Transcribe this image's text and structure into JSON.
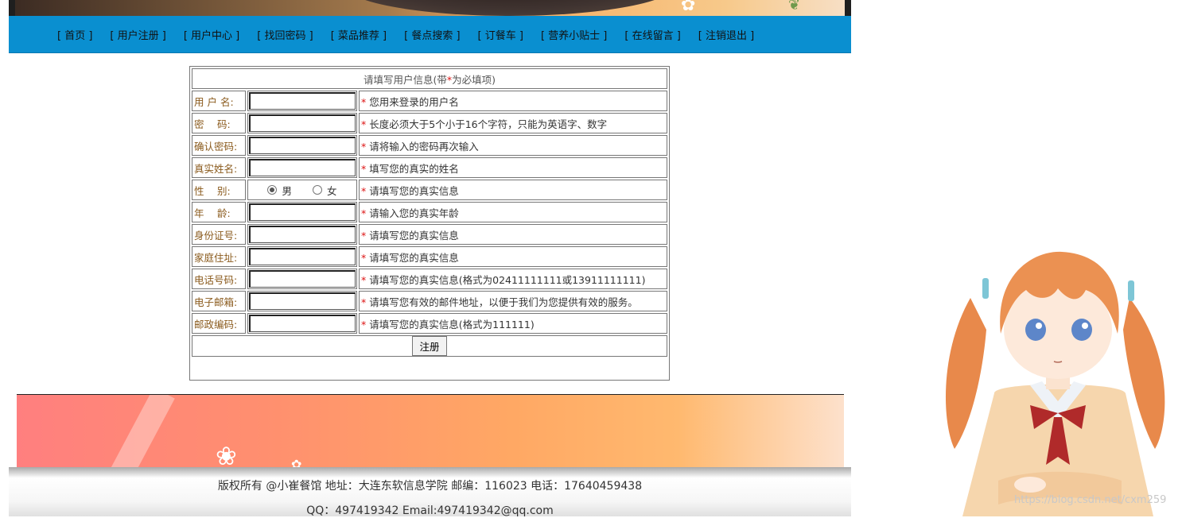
{
  "nav": {
    "items": [
      "[ 首页 ]",
      "[ 用户注册 ]",
      "[ 用户中心 ]",
      "[ 找回密码 ]",
      "[ 菜品推荐 ]",
      "[ 餐点搜索 ]",
      "[ 订餐车 ]",
      "[ 营养小贴士 ]",
      "[ 在线留言 ]",
      "[ 注销退出 ]"
    ]
  },
  "form": {
    "header_pre": "请填写用户信息(带",
    "header_star": "*",
    "header_post": "为必填项)",
    "star": "*",
    "rows": [
      {
        "label": "用 户 名:",
        "hint": "您用来登录的用户名"
      },
      {
        "label": "密　 码:",
        "hint": "长度必须大于5个小于16个字符，只能为英语字、数字"
      },
      {
        "label": "确认密码:",
        "hint": "请将输入的密码再次输入"
      },
      {
        "label": "真实姓名:",
        "hint": "填写您的真实的姓名"
      },
      {
        "label": "性　 别:",
        "hint": "请填写您的真实信息"
      },
      {
        "label": "年　 龄:",
        "hint": "请输入您的真实年龄"
      },
      {
        "label": "身份证号:",
        "hint": "请填写您的真实信息"
      },
      {
        "label": "家庭住址:",
        "hint": "请填写您的真实信息"
      },
      {
        "label": "电话号码:",
        "hint": "请填写您的真实信息(格式为02411111111或13911111111)"
      },
      {
        "label": "电子邮箱:",
        "hint": "请填写您有效的邮件地址，以便于我们为您提供有效的服务。"
      },
      {
        "label": "邮政编码:",
        "hint": "请填写您的真实信息(格式为111111)"
      }
    ],
    "gender_options": [
      "男",
      "女"
    ],
    "gender_selected": "男",
    "submit_label": "注册"
  },
  "footer": {
    "line1": "版权所有 @小崔餐馆 地址：大连东软信息学院 邮编：116023 电话：17640459438",
    "line2": "QQ：497419342  Email:497419342@qq.com"
  },
  "watermark": "https://blog.csdn.net/cxm259"
}
